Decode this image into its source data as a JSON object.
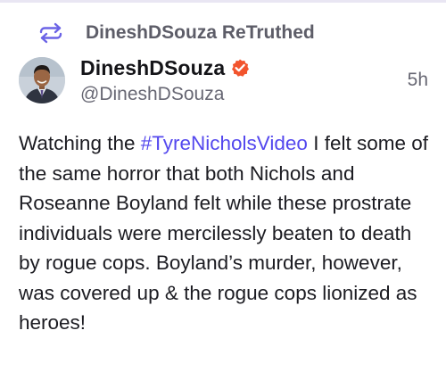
{
  "retruth": {
    "label": "DineshDSouza ReTruthed",
    "icon": "retruth-icon"
  },
  "author": {
    "display_name": "DineshDSouza",
    "handle": "@DineshDSouza",
    "verified_icon": "verified-badge-icon"
  },
  "post": {
    "timestamp": "5h",
    "text_before": "Watching the ",
    "hashtag": "#TyreNicholsVideo",
    "text_after": " I felt some of the same horror that both Nichols and Roseanne Boyland felt while these prostrate individuals were mercilessly beaten to death by rogue cops. Boyland’s murder, however, was covered up & the rogue cops lionized as heroes!"
  },
  "colors": {
    "accent": "#5448ee",
    "verified": "#f2542d",
    "muted_text": "#676773",
    "retruth_icon": "#6b63e6"
  }
}
